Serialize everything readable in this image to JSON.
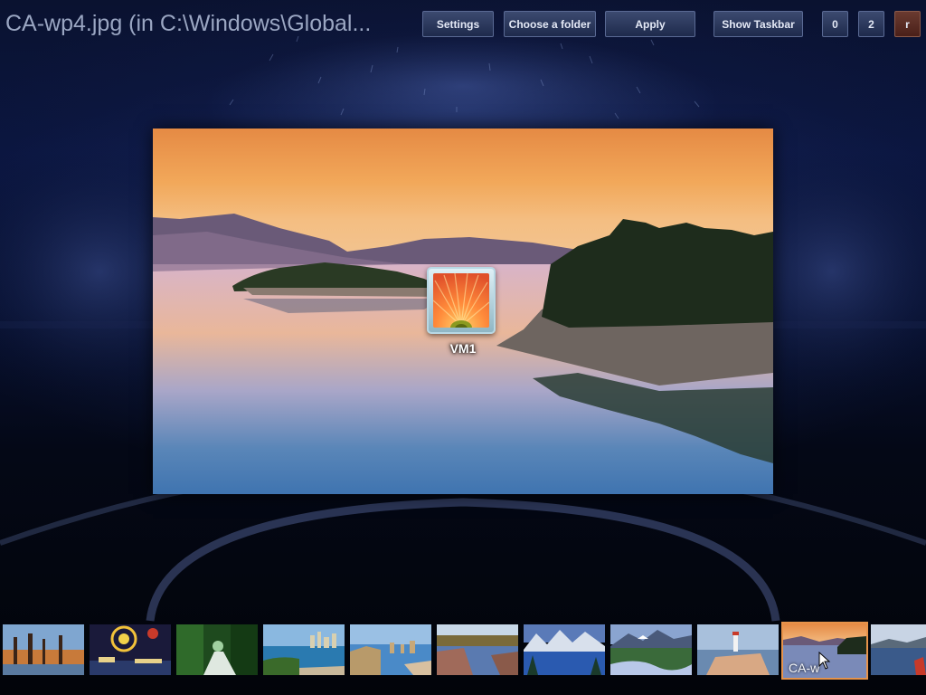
{
  "window": {
    "title": "CA-wp4.jpg (in C:\\Windows\\Global..."
  },
  "toolbar": {
    "settings_label": "Settings",
    "choose_folder_label": "Choose a folder",
    "apply_label": "Apply",
    "show_taskbar_label": "Show Taskbar",
    "btn_0_label": "0",
    "btn_2_label": "2",
    "btn_r_label": "r"
  },
  "preview": {
    "user_tile_name": "VM1"
  },
  "filmstrip": {
    "selected_caption": "CA-w",
    "thumbnails": [
      {
        "scene": "baobab-trees"
      },
      {
        "scene": "fireworks"
      },
      {
        "scene": "rainforest-stream"
      },
      {
        "scene": "city-harbor"
      },
      {
        "scene": "sea-stacks-coast"
      },
      {
        "scene": "river-rocks"
      },
      {
        "scene": "lake-mountains"
      },
      {
        "scene": "mountain-creek"
      },
      {
        "scene": "lighthouse"
      },
      {
        "scene": "sunset-lake",
        "selected": true
      },
      {
        "scene": "misty-lake"
      }
    ]
  },
  "colors": {
    "background": "#0a1230",
    "button_bg": "#2a365a",
    "button_border": "#5a6a94",
    "red_button_bg": "#5a2a24",
    "selection_border": "#e6934a"
  }
}
